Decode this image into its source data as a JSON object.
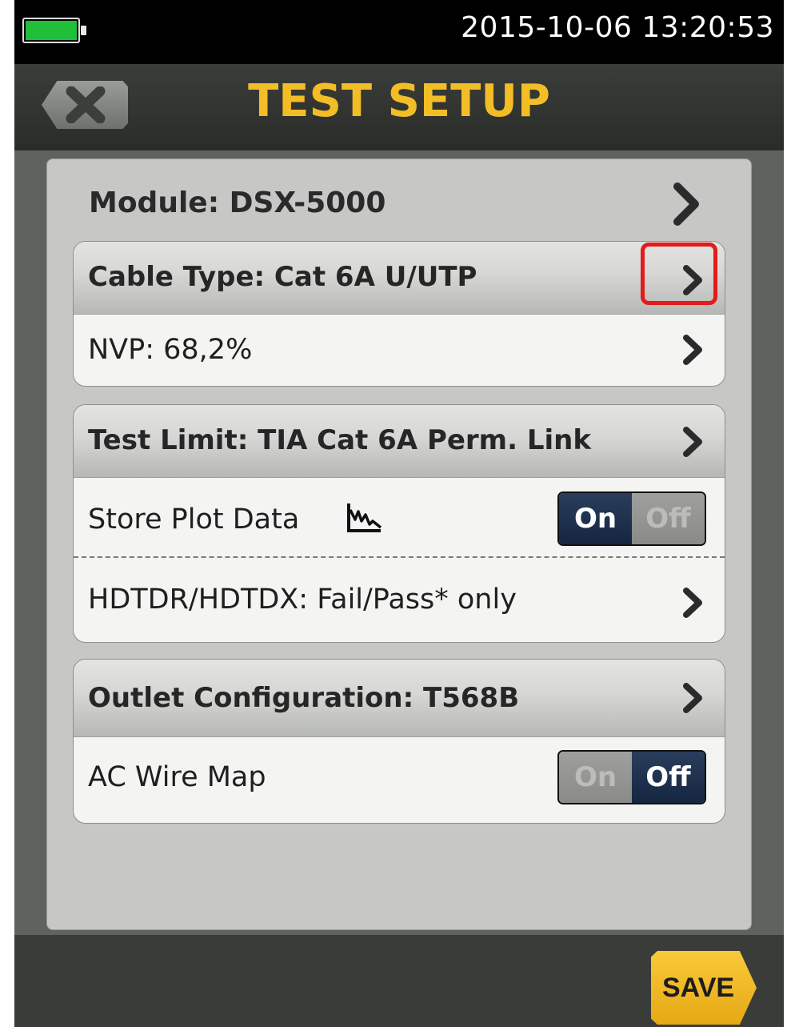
{
  "status_bar": {
    "battery_icon": "battery-full-icon",
    "battery_color": "#1fbf3a",
    "datetime": "2015-10-06 13:20:53"
  },
  "header": {
    "back_icon": "close-icon",
    "title": "TEST SETUP",
    "title_color": "#f3bd26"
  },
  "module": {
    "label": "Module: DSX-5000"
  },
  "groups": [
    {
      "header": "Cable Type: Cat 6A U/UTP",
      "rows": [
        {
          "label": "NVP: 68,2%"
        }
      ]
    },
    {
      "header": "Test Limit: TIA Cat 6A Perm. Link",
      "rows": [
        {
          "label": "Store Plot Data",
          "icon": "plot-icon",
          "toggle": {
            "on": "On",
            "off": "Off",
            "value": "On"
          }
        },
        {
          "label": "HDTDR/HDTDX: Fail/Pass* only"
        }
      ]
    },
    {
      "header": "Outlet Configuration: T568B",
      "rows": [
        {
          "label": "AC Wire Map",
          "toggle": {
            "on": "On",
            "off": "Off",
            "value": "Off"
          }
        }
      ]
    }
  ],
  "highlight": {
    "target": "cable-type-chevron",
    "color": "#e31b1b"
  },
  "footer": {
    "save_label": "SAVE",
    "save_color": "#f3bd26"
  }
}
